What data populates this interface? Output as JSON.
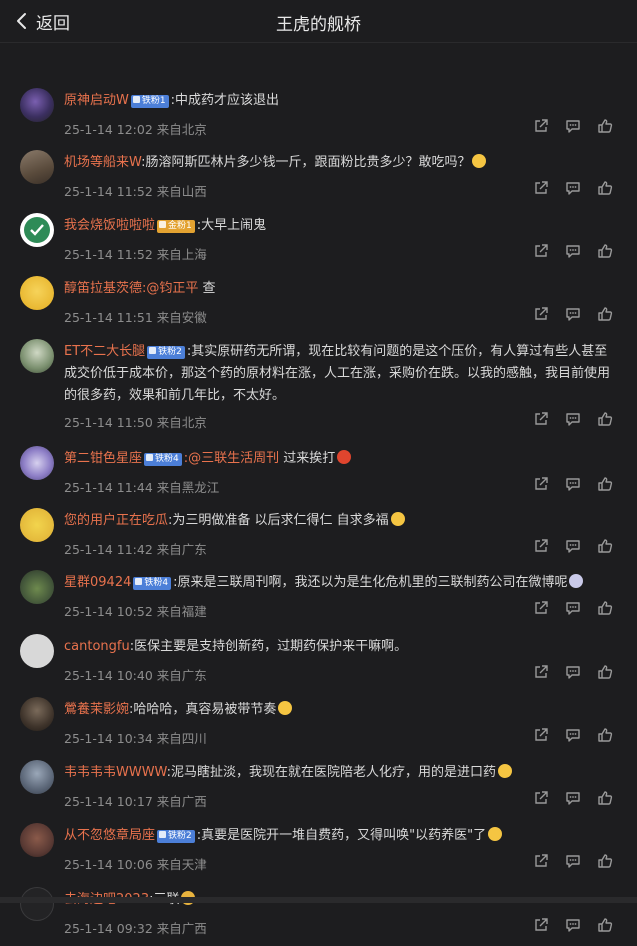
{
  "header": {
    "back_label": "返回",
    "title": "王虎的舰桥"
  },
  "comments": [
    {
      "name": "原神启动W",
      "badge": "铁粉1",
      "text": ":中成药才应该退出",
      "meta": "25-1-14 12:02 来自北京"
    },
    {
      "name": "机场等船来W",
      "text": ":肠溶阿斯匹林片多少钱一斤，跟面粉比贵多少？敢吃吗？",
      "meta": "25-1-14 11:52 来自山西"
    },
    {
      "name": "我会烧饭啦啦啦",
      "badge": "金粉1",
      "text": ":大早上闹鬼",
      "meta": "25-1-14 11:52 来自上海"
    },
    {
      "name": "醇笛拉基茨德",
      "mention": ":@钧正平",
      "text": " 查",
      "meta": "25-1-14 11:51 来自安徽"
    },
    {
      "name": "ET不二大长腿",
      "badge": "铁粉2",
      "text": ":其实原研药无所谓，现在比较有问题的是这个压价，有人算过有些人甚至成交价低于成本价，那这个药的原材料在涨，人工在涨，采购价在跌。以我的感触，我目前使用的很多药，效果和前几年比，不太好。",
      "meta": "25-1-14 11:50 来自北京"
    },
    {
      "name": "第二钳色星座",
      "badge": "铁粉4",
      "mention": ":@三联生活周刊",
      "text": " 过来挨打",
      "meta": "25-1-14 11:44 来自黑龙江"
    },
    {
      "name": "您的用户正在吃瓜",
      "text": ":为三明做准备 以后求仁得仁 自求多福",
      "meta": "25-1-14 11:42 来自广东"
    },
    {
      "name": "星群09424",
      "badge": "铁粉4",
      "text": ":原来是三联周刊啊，我还以为是生化危机里的三联制药公司在微博呢",
      "meta": "25-1-14 10:52 来自福建"
    },
    {
      "name": "cantongfu",
      "text": ":医保主要是支持创新药，过期药保护来干嘛啊。",
      "meta": "25-1-14 10:40 来自广东"
    },
    {
      "name": "鶯養茉影婉",
      "text": ":哈哈哈，真容易被带节奏",
      "meta": "25-1-14 10:34 来自四川"
    },
    {
      "name": "韦韦韦韦WWWW",
      "text": ":泥马瞎扯淡，我现在就在医院陪老人化疗，用的是进口药",
      "meta": "25-1-14 10:17 来自广西"
    },
    {
      "name": "从不忽悠章局座",
      "badge": "铁粉2",
      "text": ":真要是医院开一堆自费药，又得叫唤\"以药养医\"了",
      "meta": "25-1-14 10:06 来自天津"
    },
    {
      "name": "去海边吧2023",
      "text": ":三联",
      "meta": "25-1-14 09:32 来自广西"
    }
  ],
  "icons": {
    "share": "share-icon",
    "comment": "comment-icon",
    "like": "thumbs-up-icon",
    "back": "chevron-left-icon"
  },
  "colors": {
    "username": "#e8724d",
    "background": "#1d1d1f",
    "meta": "#8d8d8d",
    "badge_blue": "#4c7fd8",
    "badge_gold": "#e3a231"
  }
}
